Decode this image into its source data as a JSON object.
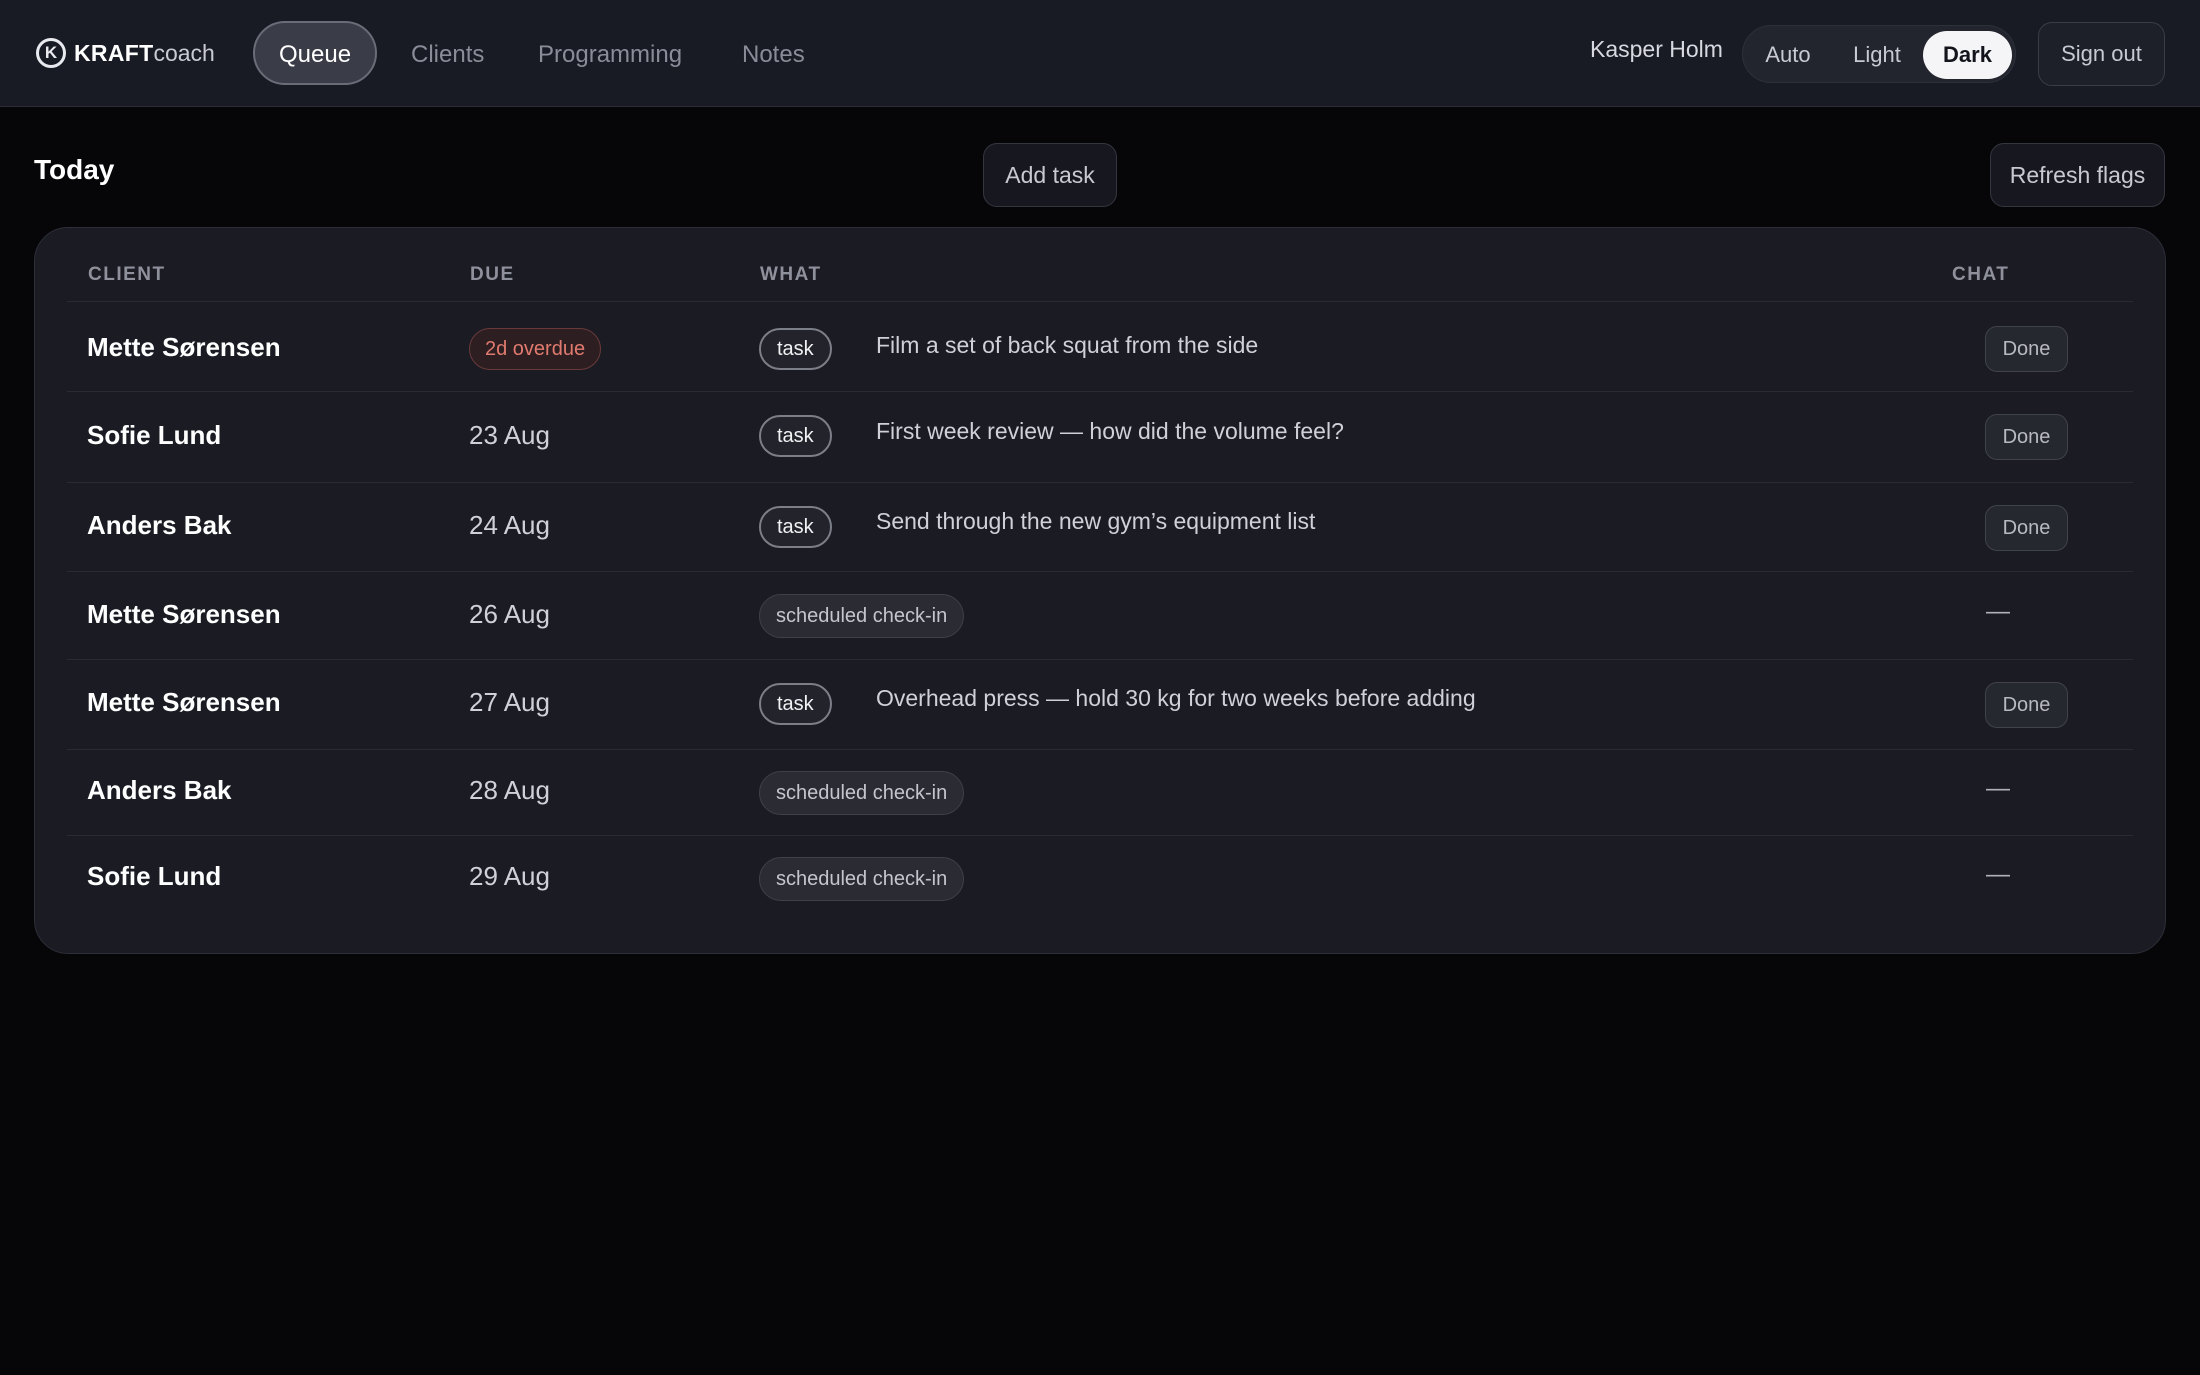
{
  "header": {
    "logo": {
      "icon": "k-circle-logo-icon",
      "mark": "K",
      "strong": "KRAFT",
      "light": "coach"
    },
    "nav": [
      {
        "label": "Queue",
        "active": true
      },
      {
        "label": "Clients",
        "active": false
      },
      {
        "label": "Programming",
        "active": false
      },
      {
        "label": "Notes",
        "active": false
      }
    ],
    "user_name": "Kasper Holm",
    "theme_options": [
      {
        "label": "Auto",
        "active": false
      },
      {
        "label": "Light",
        "active": false
      },
      {
        "label": "Dark",
        "active": true
      }
    ],
    "sign_out_label": "Sign out"
  },
  "main": {
    "title": "Today",
    "add_task_label": "Add task",
    "refresh_flags_label": "Refresh flags",
    "table": {
      "columns": [
        "CLIENT",
        "DUE",
        "WHAT",
        "CHAT"
      ],
      "rows": [
        {
          "client": "Mette Sørensen",
          "due": "2d overdue",
          "overdue": true,
          "type": "task",
          "what": "Film a set of back squat from the side",
          "chat": "Done"
        },
        {
          "client": "Sofie Lund",
          "due": "23 Aug",
          "overdue": false,
          "type": "task",
          "what": "First week review — how did the volume feel?",
          "chat": "Done"
        },
        {
          "client": "Anders Bak",
          "due": "24 Aug",
          "overdue": false,
          "type": "task",
          "what": "Send through the new gym’s equipment list",
          "chat": "Done"
        },
        {
          "client": "Mette Sørensen",
          "due": "26 Aug",
          "overdue": false,
          "type": "scheduled check-in",
          "what": "",
          "chat": "—"
        },
        {
          "client": "Mette Sørensen",
          "due": "27 Aug",
          "overdue": false,
          "type": "task",
          "what": "Overhead press — hold 30 kg for two weeks before adding",
          "chat": "Done"
        },
        {
          "client": "Anders Bak",
          "due": "28 Aug",
          "overdue": false,
          "type": "scheduled check-in",
          "what": "",
          "chat": "—"
        },
        {
          "client": "Sofie Lund",
          "due": "29 Aug",
          "overdue": false,
          "type": "scheduled check-in",
          "what": "",
          "chat": "—"
        }
      ]
    }
  },
  "colors": {
    "background": "#060608",
    "topbar": "#181a24",
    "card": "#1a1b23",
    "overdue": "#e07a6e",
    "active_toggle": "#f5f5f7"
  }
}
